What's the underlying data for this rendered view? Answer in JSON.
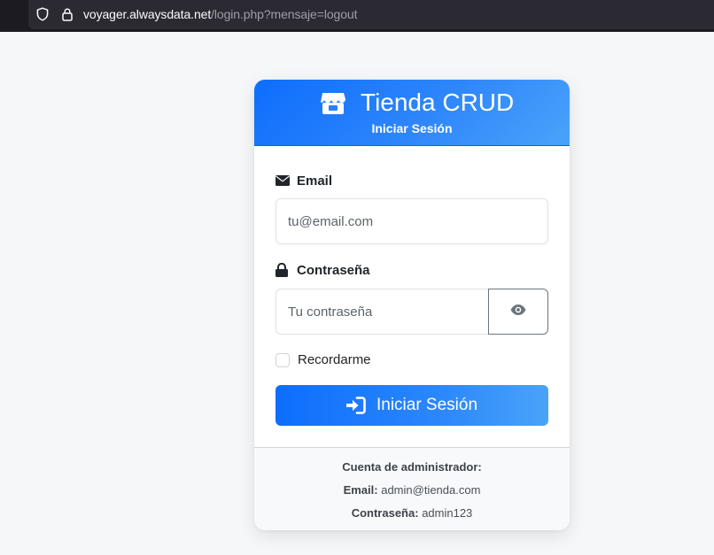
{
  "browser": {
    "url_host": "voyager.alwaysdata.net",
    "url_path": "/login.php?mensaje=logout",
    "icons": [
      "shield-icon",
      "lock-icon"
    ]
  },
  "header": {
    "title": "Tienda CRUD",
    "subtitle": "Iniciar Sesión",
    "icon": "store-icon"
  },
  "form": {
    "email": {
      "label": "Email",
      "placeholder": "tu@email.com",
      "value": "",
      "icon": "envelope-icon"
    },
    "password": {
      "label": "Contraseña",
      "placeholder": "Tu contraseña",
      "value": "",
      "icon": "lock-icon",
      "toggle_icon": "eye-icon"
    },
    "remember": {
      "label": "Recordarme",
      "checked": false
    },
    "submit": {
      "label": "Iniciar Sesión",
      "icon": "sign-in-icon"
    }
  },
  "footer": {
    "heading": "Cuenta de administrador:",
    "email_label": "Email:",
    "email_value": "admin@tienda.com",
    "password_label": "Contraseña:",
    "password_value": "admin123"
  },
  "colors": {
    "primary": "#0d6efd",
    "primary_light": "#4aa3f9",
    "page_bg": "#f6f7f9",
    "browser_bg": "#1c1b22"
  }
}
